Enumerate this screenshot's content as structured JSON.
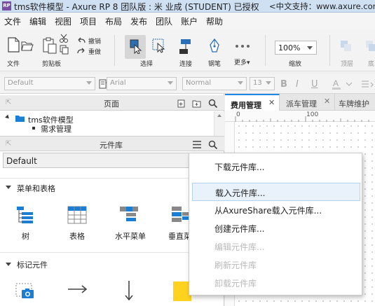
{
  "window": {
    "title": "tms软件模型 - Axure RP 8 团队版 : 米 业成 (STUDENT) 已授权",
    "support_text": "<中文支持：www.axure.com",
    "app_icon_text": "RP"
  },
  "menu": [
    "文件",
    "编辑",
    "视图",
    "项目",
    "布局",
    "发布",
    "团队",
    "账户",
    "帮助"
  ],
  "toolbar": {
    "file_label": "文件",
    "clipboard_label": "剪贴板",
    "undo_label": "撤销",
    "redo_label": "重做",
    "select_label": "选择",
    "connect_label": "连接",
    "pen_label": "钢笔",
    "more_label": "更多▾",
    "zoom_value": "100%",
    "zoom_label": "缩放",
    "top_label": "顶层",
    "bottom_label": "底"
  },
  "format": {
    "style_value": "Default",
    "font_value": "Arial",
    "weight_value": "Normal",
    "size_value": "13"
  },
  "pages_panel": {
    "title": "页面",
    "tree_root": "tms软件模型",
    "tree_child": "需求管理"
  },
  "library_panel": {
    "title": "元件库",
    "selected_library": "Default",
    "section1": "菜单和表格",
    "section1_items": [
      "树",
      "表格",
      "水平菜单",
      "垂直菜"
    ],
    "section2": "标记元件"
  },
  "canvas": {
    "tabs": [
      "费用管理",
      "派车管理",
      "车牌维护"
    ],
    "ruler_marks": [
      "0",
      "100"
    ]
  },
  "dropdown": {
    "items": [
      {
        "label": "下载元件库...",
        "enabled": true
      },
      {
        "label": "载入元件库...",
        "enabled": true
      },
      {
        "label": "从AxureShare载入元件库...",
        "enabled": true
      },
      {
        "label": "创建元件库...",
        "enabled": true
      },
      {
        "label": "编辑元件库...",
        "enabled": false
      },
      {
        "label": "刷新元件库",
        "enabled": false
      },
      {
        "label": "卸载元件库",
        "enabled": false
      }
    ]
  },
  "colors": {
    "accent": "#1e88e5",
    "folder": "#1a7fd4",
    "highlight": "#e9f2fb",
    "postit": "#ffd21f"
  }
}
